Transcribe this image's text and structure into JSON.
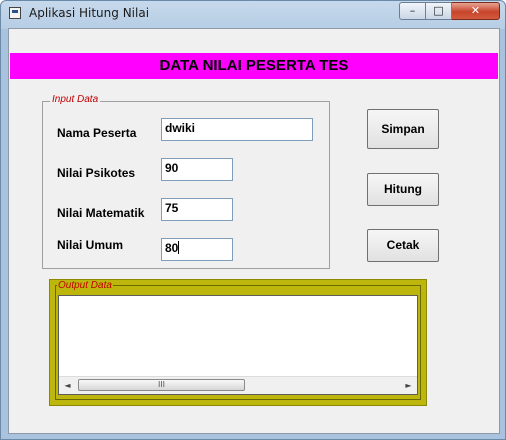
{
  "window": {
    "title": "Aplikasi Hitung Nilai",
    "controls": {
      "minimize": "–",
      "maximize": "□",
      "close": "✕"
    }
  },
  "banner": {
    "text": "DATA NILAI PESERTA TES",
    "color": "#ff00ff"
  },
  "input_frame": {
    "legend": "Input Data",
    "fields": [
      {
        "label": "Nama Peserta",
        "value": "dwiki"
      },
      {
        "label": "Nilai Psikotes",
        "value": "90"
      },
      {
        "label": "Nilai Matematik",
        "value": "75"
      },
      {
        "label": "Nilai Umum",
        "value": "80"
      }
    ]
  },
  "buttons": {
    "simpan": "Simpan",
    "hitung": "Hitung",
    "cetak": "Cetak"
  },
  "output_frame": {
    "legend": "Output Data",
    "color": "#bdb70d",
    "scroll": {
      "left": "◄",
      "right": "►",
      "thumb": "III"
    }
  },
  "icons": {
    "app": "app-window-icon"
  }
}
